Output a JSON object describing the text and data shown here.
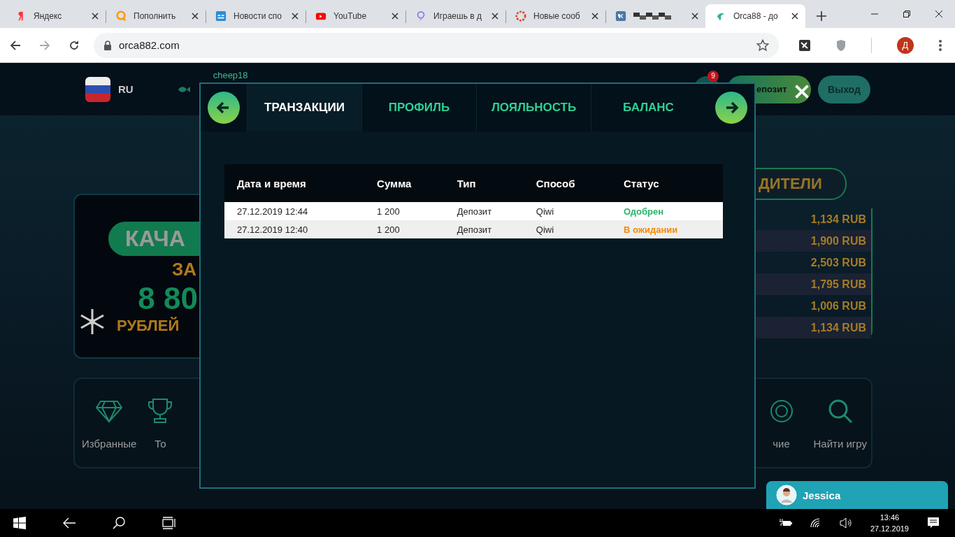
{
  "browser": {
    "tabs": [
      {
        "kind": "yandex",
        "title": "Яндекс",
        "selected": false
      },
      {
        "kind": "qiwi",
        "title": "Пополнить",
        "selected": false
      },
      {
        "kind": "sb",
        "title": "Новости спо",
        "selected": false
      },
      {
        "kind": "youtube",
        "title": "YouTube",
        "selected": false
      },
      {
        "kind": "game",
        "title": "Играешь в д",
        "selected": false
      },
      {
        "kind": "chat",
        "title": "Новые сооб",
        "selected": false
      },
      {
        "kind": "vk",
        "selected": false
      },
      {
        "kind": "orca",
        "title": "Orca88 - до",
        "selected": true
      }
    ],
    "url": "orca882.com",
    "profile_initial": "Д"
  },
  "site": {
    "header": {
      "language": "RU",
      "username": "cheep18",
      "notification_count": "9",
      "deposit_label": "епозит",
      "logout_label": "Выход"
    },
    "banner": {
      "title": "КАЧА",
      "prefix": "ЗА",
      "amount": "8 80",
      "currency": "РУБЛЕЙ"
    },
    "leaderboard": {
      "title": "ДИТЕЛИ",
      "amounts": [
        "1,134 RUB",
        "1,900 RUB",
        "2,503 RUB",
        "1,795 RUB",
        "1,006 RUB",
        "1,134 RUB"
      ]
    },
    "nav": [
      {
        "kind": "diamond",
        "label": "Избранные"
      },
      {
        "kind": "trophy",
        "label": "То"
      },
      {
        "kind": "chip",
        "label": "чие"
      },
      {
        "kind": "search",
        "label": "Найти игру"
      }
    ]
  },
  "modal": {
    "tabs": [
      {
        "label": "ТРАНЗАКЦИИ",
        "selected": true
      },
      {
        "label": "ПРОФИЛЬ",
        "selected": false
      },
      {
        "label": "ЛОЯЛЬНОСТЬ",
        "selected": false
      },
      {
        "label": "БАЛАНС",
        "selected": false
      }
    ],
    "table": {
      "columns": [
        "Дата и время",
        "Сумма",
        "Тип",
        "Способ",
        "Статус"
      ],
      "rows": [
        {
          "date": "27.12.2019 12:44",
          "amount": "1 200",
          "type": "Депозит",
          "method": "Qiwi",
          "status": "Одобрен",
          "kind": "approved"
        },
        {
          "date": "27.12.2019 12:40",
          "amount": "1 200",
          "type": "Депозит",
          "method": "Qiwi",
          "status": "В ожидании",
          "kind": "pending"
        }
      ]
    }
  },
  "chat": {
    "agent": "Jessica"
  },
  "taskbar": {
    "time": "13:46",
    "date": "27.12.2019"
  }
}
